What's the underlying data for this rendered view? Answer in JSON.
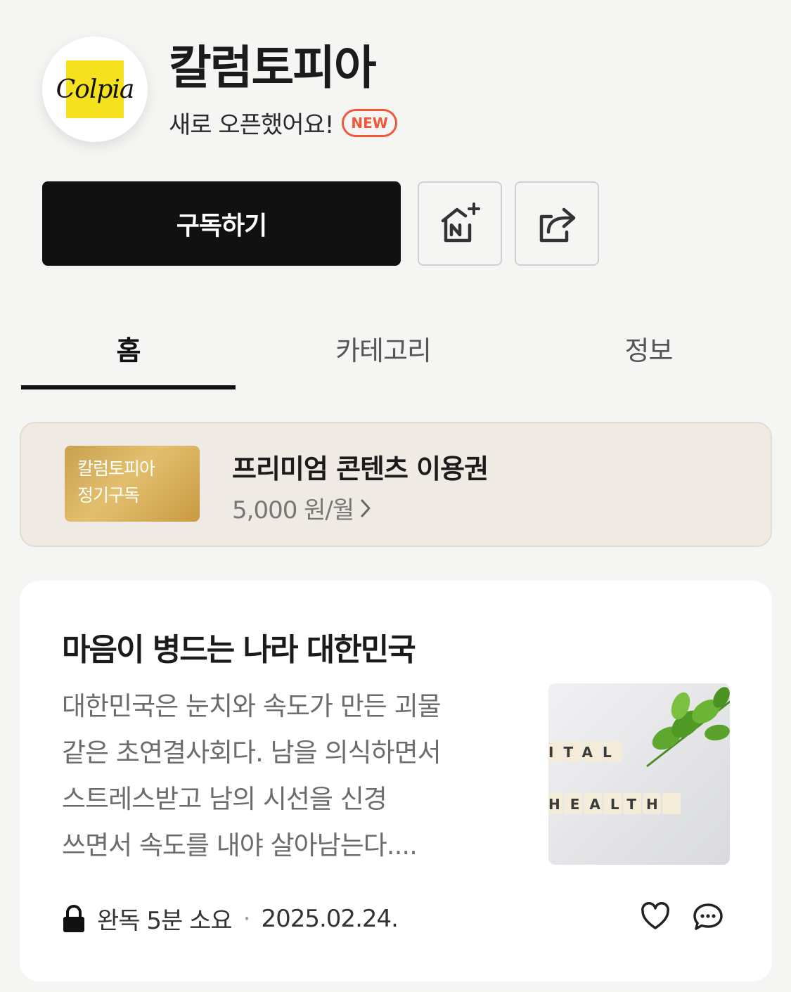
{
  "channel": {
    "logo_text": "Colpia",
    "name": "칼럼토피아",
    "subtitle": "새로 오픈했어요!",
    "badge": "NEW"
  },
  "actions": {
    "subscribe_label": "구독하기",
    "home_icon": "naver-home-add-icon",
    "share_icon": "share-icon"
  },
  "tabs": [
    {
      "label": "홈",
      "active": true
    },
    {
      "label": "카테고리",
      "active": false
    },
    {
      "label": "정보",
      "active": false
    }
  ],
  "premium": {
    "ticket_line1": "칼럼토피아",
    "ticket_line2": "정기구독",
    "title": "프리미엄 콘텐츠 이용권",
    "price": "5,000 원/월"
  },
  "article": {
    "title": "마음이 병드는 나라 대한민국",
    "excerpt_lines": [
      "대한민국은 눈치와 속도가 만든 괴물",
      "같은 초연결사회다. 남을 의식하면서",
      "스트레스받고 남의 시선을 신경",
      "쓰면서 속도를 내야 살아남는다...."
    ],
    "thumb_word1": "ITAL",
    "thumb_word2": "HEALTH",
    "read_time": "완독 5분 소요",
    "separator": "·",
    "date": "2025.02.24."
  },
  "colors": {
    "badge": "#f0583a",
    "logo_yellow": "#f6e21c",
    "ticket_gold": "#d8b15e"
  }
}
